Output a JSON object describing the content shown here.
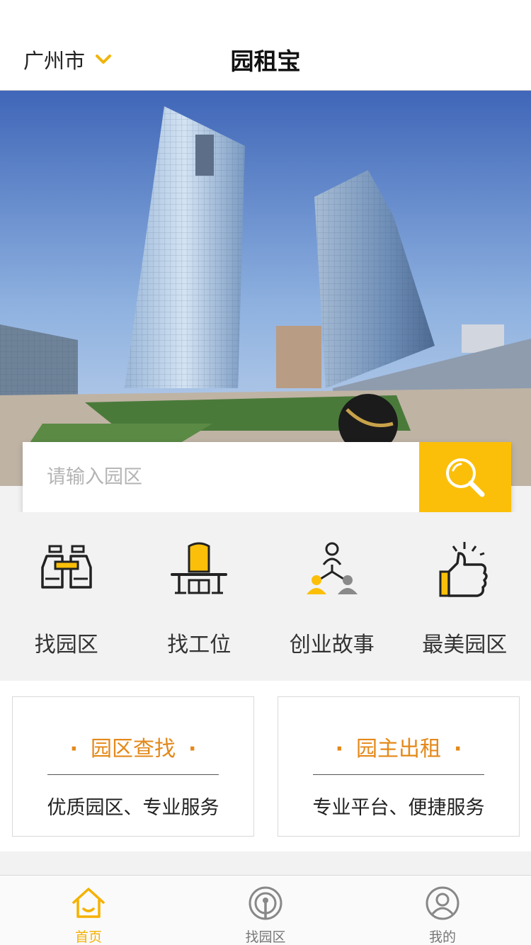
{
  "header": {
    "city": "广州市",
    "title": "园租宝"
  },
  "search": {
    "placeholder": "请输入园区"
  },
  "quick_links": [
    {
      "label": "找园区",
      "icon": "binoculars-icon"
    },
    {
      "label": "找工位",
      "icon": "workstation-icon"
    },
    {
      "label": "创业故事",
      "icon": "team-icon"
    },
    {
      "label": "最美园区",
      "icon": "thumbs-up-icon"
    }
  ],
  "cards": [
    {
      "title": "园区查找",
      "subtitle": "优质园区、专业服务"
    },
    {
      "title": "园主出租",
      "subtitle": "专业平台、便捷服务"
    }
  ],
  "tabbar": [
    {
      "label": "首页",
      "icon": "home-icon",
      "active": true
    },
    {
      "label": "找园区",
      "icon": "broadcast-icon",
      "active": false
    },
    {
      "label": "我的",
      "icon": "user-icon",
      "active": false
    }
  ],
  "colors": {
    "accent": "#fbbf0a",
    "card_title": "#e4891a",
    "tab_active": "#f5b100"
  }
}
